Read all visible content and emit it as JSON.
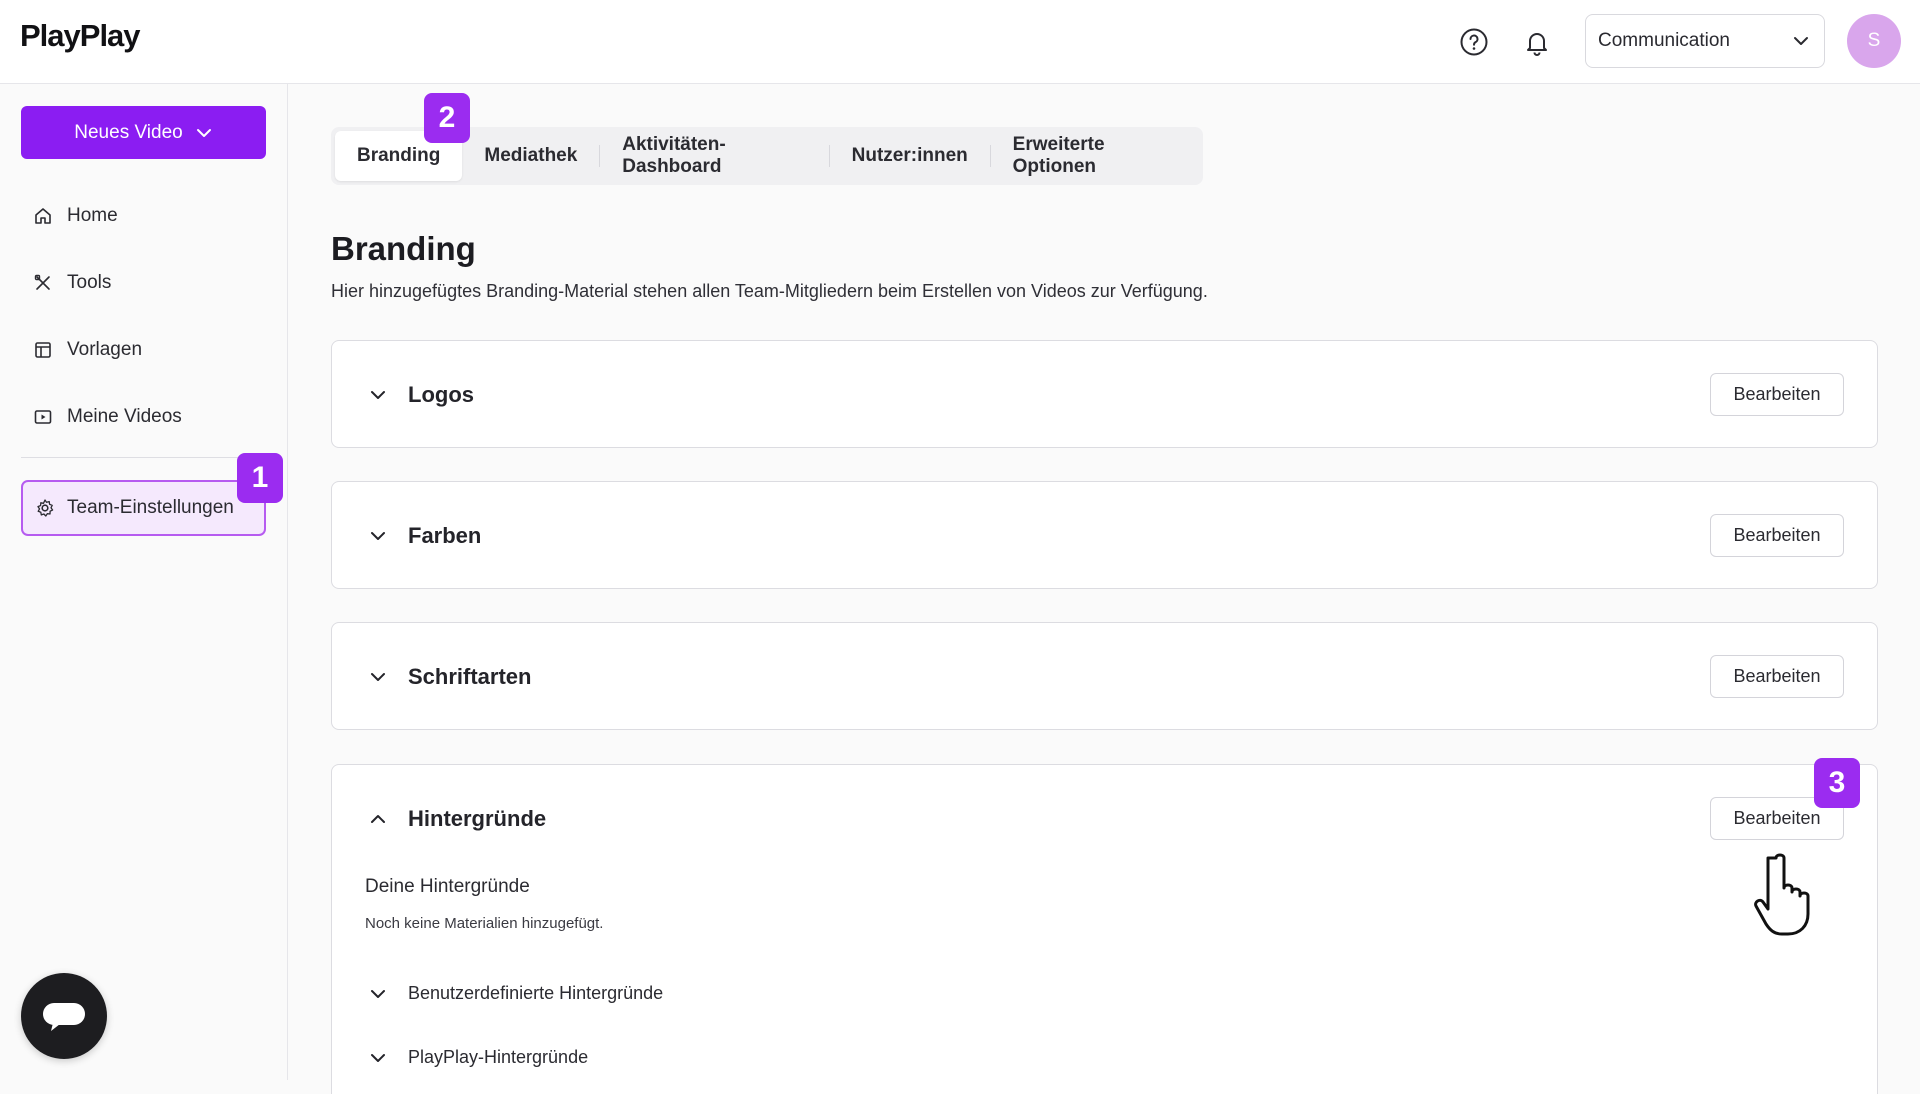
{
  "topbar": {
    "logo": "PlayPlay",
    "team_select": "Communication",
    "avatar_initial": "S"
  },
  "sidebar": {
    "new_video_label": "Neues Video",
    "items": [
      {
        "label": "Home",
        "icon": "home-icon"
      },
      {
        "label": "Tools",
        "icon": "tools-icon"
      },
      {
        "label": "Vorlagen",
        "icon": "template-icon"
      },
      {
        "label": "Meine Videos",
        "icon": "video-icon"
      }
    ],
    "team_settings_label": "Team-Einstellungen"
  },
  "tabs": [
    {
      "label": "Branding",
      "active": true
    },
    {
      "label": "Mediathek",
      "active": false
    },
    {
      "label": "Aktivitäten-Dashboard",
      "active": false
    },
    {
      "label": "Nutzer:innen",
      "active": false
    },
    {
      "label": "Erweiterte Optionen",
      "active": false
    }
  ],
  "page": {
    "title": "Branding",
    "subtitle": "Hier hinzugefügtes Branding-Material stehen allen Team-Mitgliedern beim Erstellen von Videos zur Verfügung."
  },
  "panels": [
    {
      "title": "Logos",
      "edit_label": "Bearbeiten",
      "expanded": false
    },
    {
      "title": "Farben",
      "edit_label": "Bearbeiten",
      "expanded": false
    },
    {
      "title": "Schriftarten",
      "edit_label": "Bearbeiten",
      "expanded": false
    },
    {
      "title": "Hintergründe",
      "edit_label": "Bearbeiten",
      "expanded": true
    }
  ],
  "backgrounds": {
    "own_title": "Deine Hintergründe",
    "empty_text": "Noch keine Materialien hinzugefügt.",
    "custom_label": "Benutzerdefinierte Hintergründe",
    "playplay_label": "PlayPlay-Hintergründe"
  },
  "badges": [
    "1",
    "2",
    "3"
  ],
  "colors": {
    "accent": "#8b1df2",
    "badge": "#9b2cf0",
    "avatar": "#d9a6ec",
    "active_nav_bg": "#f5e9fd"
  }
}
